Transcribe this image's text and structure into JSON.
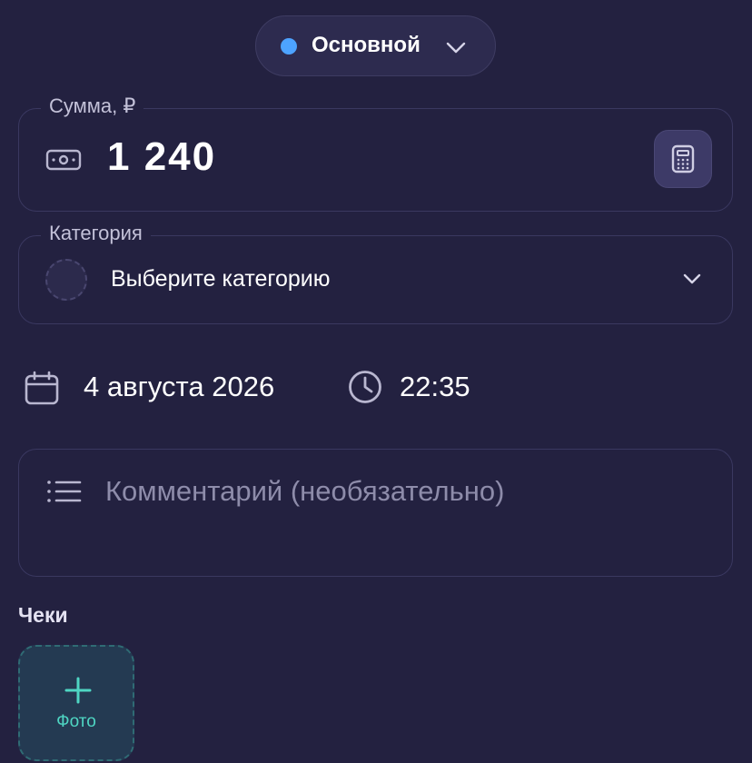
{
  "account": {
    "name": "Основной",
    "dot_color": "#4da3ff",
    "icon": "chevron-down-icon"
  },
  "amount": {
    "legend": "Сумма, ₽",
    "value": "1 240",
    "icon": "money-icon",
    "calculator_icon": "calculator-icon"
  },
  "category": {
    "legend": "Категория",
    "placeholder": "Выберите категорию",
    "icon": "chevron-down-icon"
  },
  "datetime": {
    "date": "4 августа 2026",
    "time": "22:35",
    "date_icon": "calendar-icon",
    "time_icon": "clock-icon"
  },
  "comment": {
    "placeholder": "Комментарий (необязательно)",
    "icon": "list-icon"
  },
  "receipts": {
    "heading": "Чеки",
    "add_label": "Фото",
    "accent_color": "#4fd6c3"
  }
}
